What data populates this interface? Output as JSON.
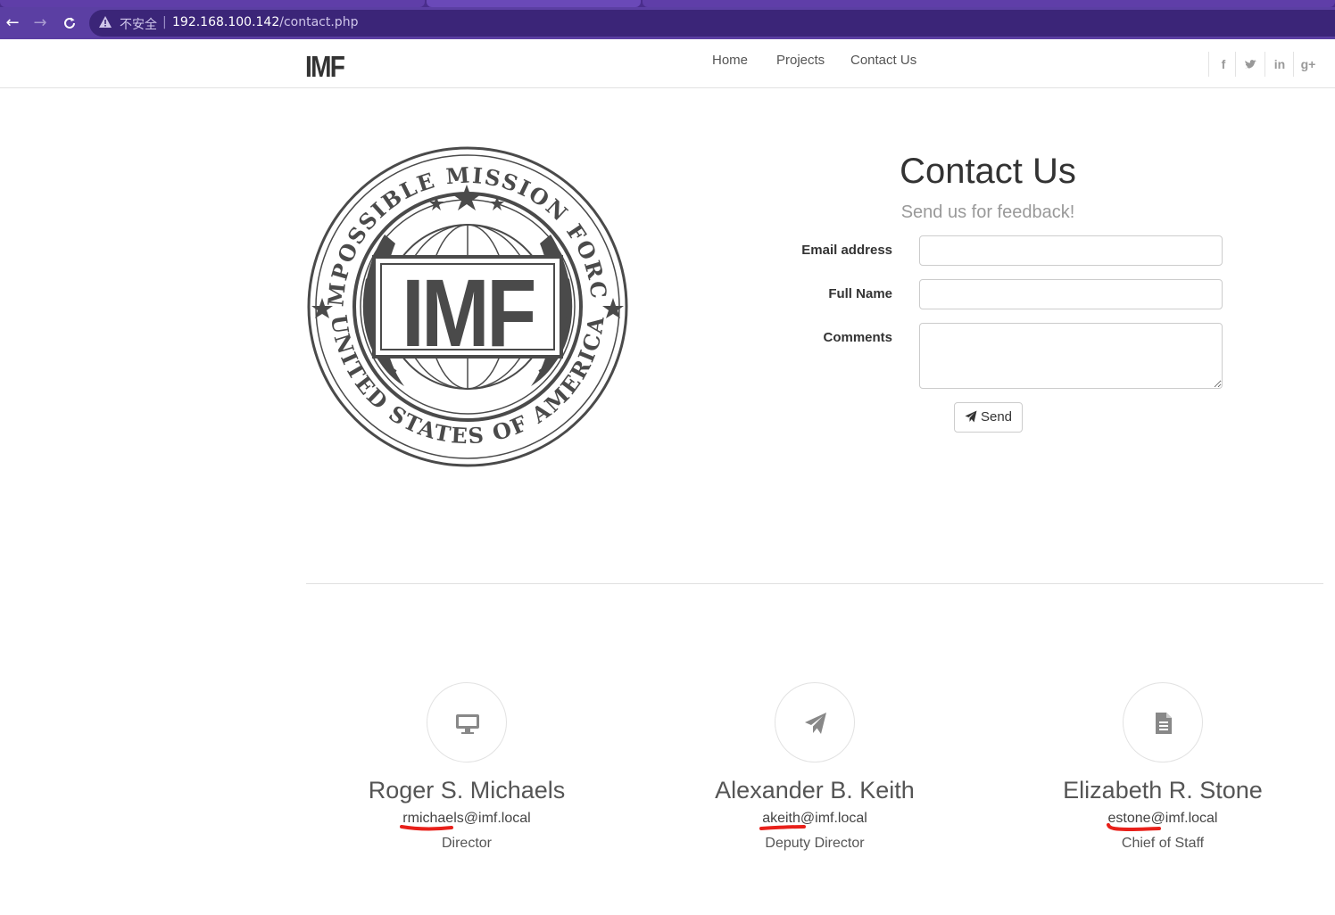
{
  "browser": {
    "insecure_label": "不安全",
    "url_host": "192.168.100.142",
    "url_path": "/contact.php",
    "accent": "#5b3fa3"
  },
  "site": {
    "brand": "IMF",
    "nav": [
      "Home",
      "Projects",
      "Contact Us"
    ],
    "social_icons": [
      "facebook-icon",
      "twitter-icon",
      "linkedin-icon",
      "google-plus-icon"
    ]
  },
  "seal": {
    "top_text": "IMPOSSIBLE MISSION FORCE",
    "bottom_text": "UNITED STATES OF AMERICA",
    "center_text": "IMF"
  },
  "contact": {
    "title": "Contact Us",
    "subtitle": "Send us for feedback!",
    "fields": {
      "email_label": "Email address",
      "name_label": "Full Name",
      "comments_label": "Comments"
    },
    "send_label": "Send"
  },
  "team": [
    {
      "icon": "desktop-icon",
      "name": "Roger S. Michaels",
      "email_user": "rmichaels",
      "email_domain": "@imf.local",
      "role": "Director"
    },
    {
      "icon": "paper-plane-icon",
      "name": "Alexander B. Keith",
      "email_user": "akeith",
      "email_domain": "@imf.local",
      "role": "Deputy Director"
    },
    {
      "icon": "document-icon",
      "name": "Elizabeth R. Stone",
      "email_user": "estone",
      "email_domain": "@imf.local",
      "role": "Chief of Staff"
    }
  ]
}
